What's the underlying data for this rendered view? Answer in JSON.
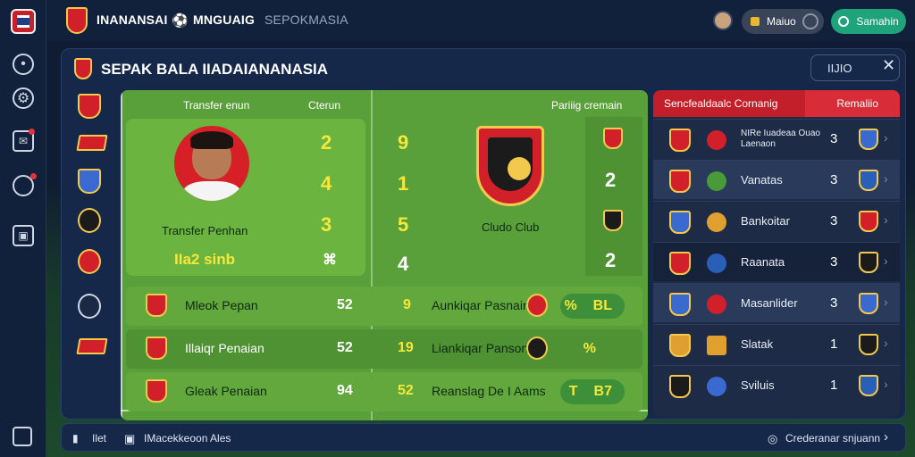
{
  "top": {
    "nav1": "INANANSAI",
    "nav2": "MNGUAIG",
    "nav3": "SEPOKMASIA",
    "user": "Maiuo",
    "action": "Samahin"
  },
  "main": {
    "title": "SEPAK BALA IIADAIANANASIA",
    "search_value": "IIJIO",
    "sub_left_a": "Transfer enun",
    "sub_left_b": "Cterun",
    "sub_mid": "Pariiig cremain",
    "player_name": "Transfer Penhan",
    "player_stat": "IIa2 sinb",
    "club_name": "Cludo Club",
    "nums_left": [
      "2",
      "4",
      "3",
      "⌘"
    ],
    "nums_mid": [
      "9",
      "1",
      "5",
      "4"
    ],
    "nums_right": [
      "2",
      "2"
    ]
  },
  "rows": [
    {
      "name": "Mleok Pepan",
      "val": "52",
      "mid": "9",
      "opp": "Aunkiqar Pasnain",
      "pct": "%",
      "tag": "BL"
    },
    {
      "name": "Illaiqr Penaian",
      "val": "52",
      "mid": "19",
      "opp": "Liankiqar Panson",
      "pct": "%",
      "tag": ""
    },
    {
      "name": "Gleak Penaian",
      "val": "94",
      "mid": "52",
      "opp": "Reanslag De I Aams",
      "pct": "T",
      "tag": "B7"
    }
  ],
  "table": {
    "header_left": "Sencfealdaalc Cornanig",
    "header_right": "Remaliio",
    "rows": [
      {
        "name": "NIRe Iuadeaa Ouao Laenaon",
        "pts": "3"
      },
      {
        "name": "Vanatas",
        "pts": "3"
      },
      {
        "name": "Bankoitar",
        "pts": "3"
      },
      {
        "name": "Raanata",
        "pts": "3"
      },
      {
        "name": "Masanlider",
        "pts": "3"
      },
      {
        "name": "Slatak",
        "pts": "1"
      },
      {
        "name": "Sviluis",
        "pts": "1"
      }
    ]
  },
  "bottom": {
    "left1": "Ilet",
    "left2": "IMacekkeoon Ales",
    "right": "Crederanar snjuann"
  },
  "colors": {
    "accent_red": "#d2202a",
    "pitch_green": "#5aa03a",
    "gold": "#f2c94c",
    "action_green": "#1fa37a"
  }
}
